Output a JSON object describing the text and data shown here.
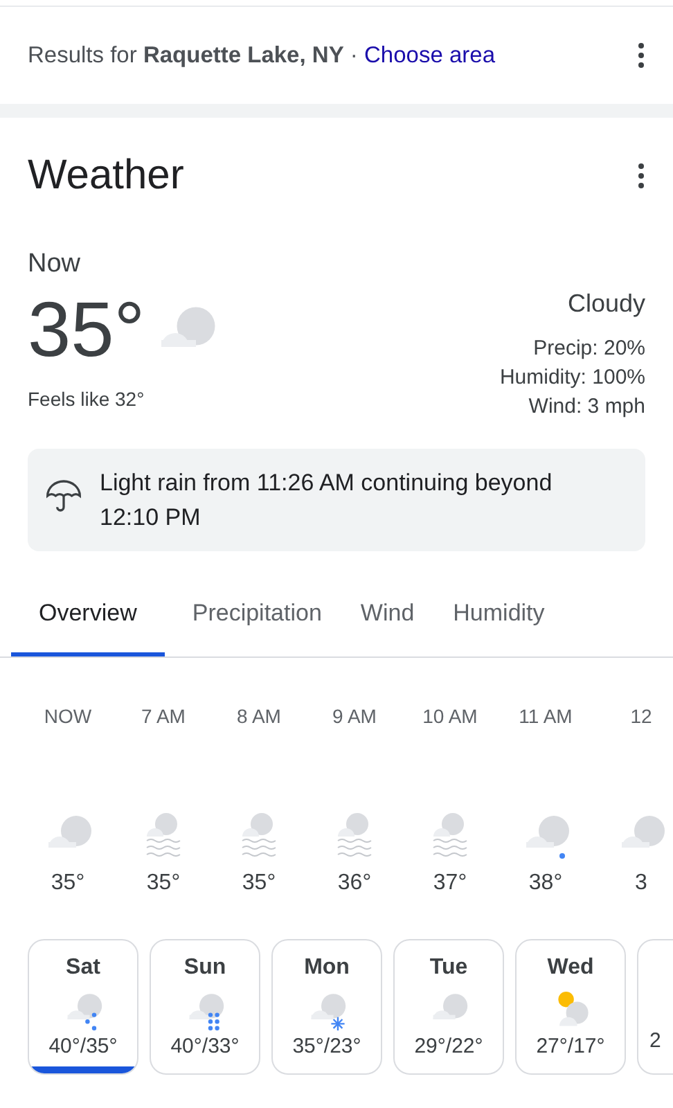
{
  "results_bar": {
    "text": "Results for **Raquette Lake, NY** ·",
    "link": "Choose area"
  },
  "weather": {
    "title": "Weather",
    "now_label": "Now",
    "temperature": "35°",
    "feels_like": "Feels like 32°",
    "condition": "Cloudy",
    "details": [
      "Precip: 20%",
      "Humidity: 100%",
      "Wind: 3 mph"
    ],
    "alert": "Light rain from 11:26 AM continuing beyond 12:10 PM"
  },
  "tabs": [
    {
      "label": "Overview",
      "selected": true
    },
    {
      "label": "Precipitation",
      "selected": false
    },
    {
      "label": "Wind",
      "selected": false
    },
    {
      "label": "Humidity",
      "selected": false
    }
  ],
  "hourly": [
    {
      "time": "NOW",
      "kind": "cloudy",
      "temp": "35°"
    },
    {
      "time": "7 AM",
      "kind": "fog",
      "temp": "35°"
    },
    {
      "time": "8 AM",
      "kind": "fog",
      "temp": "35°"
    },
    {
      "time": "9 AM",
      "kind": "fog",
      "temp": "36°"
    },
    {
      "time": "10 AM",
      "kind": "fog",
      "temp": "37°"
    },
    {
      "time": "11 AM",
      "kind": "light-rain",
      "temp": "38°"
    },
    {
      "time": "12",
      "kind": "cloudy",
      "temp": "3"
    }
  ],
  "daily": [
    {
      "day": "Sat",
      "kind": "rain",
      "temps": "40°/35°",
      "selected": true
    },
    {
      "day": "Sun",
      "kind": "heavy-rain",
      "temps": "40°/33°",
      "selected": false
    },
    {
      "day": "Mon",
      "kind": "snow",
      "temps": "35°/23°",
      "selected": false
    },
    {
      "day": "Tue",
      "kind": "cloudy",
      "temps": "29°/22°",
      "selected": false
    },
    {
      "day": "Wed",
      "kind": "partly-sunny",
      "temps": "27°/17°",
      "selected": false
    },
    {
      "temps": "2",
      "selected": false
    }
  ]
}
